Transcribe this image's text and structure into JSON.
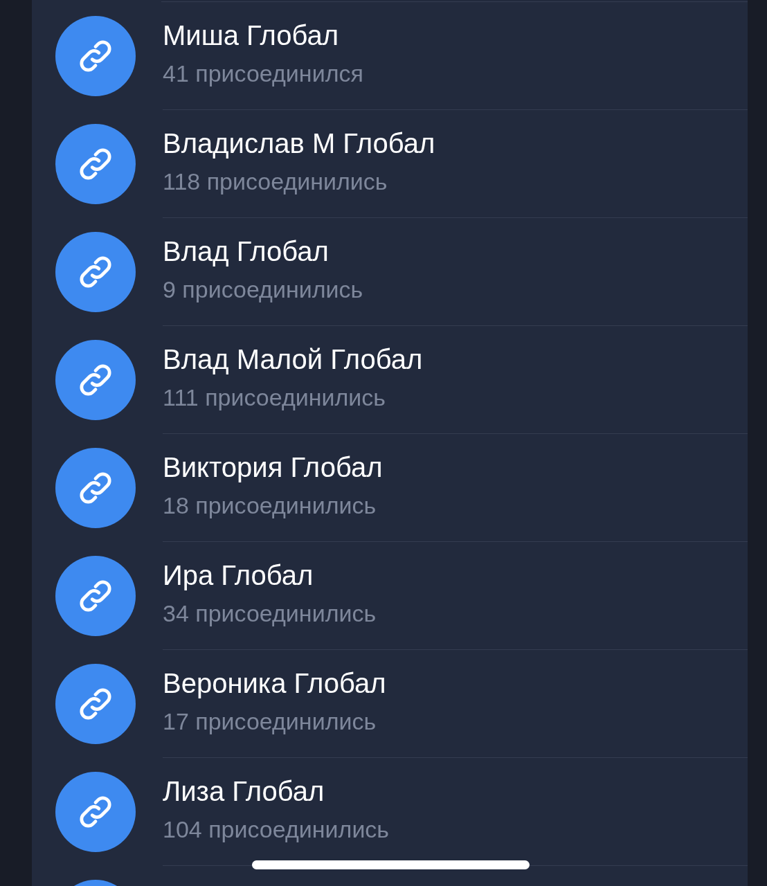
{
  "invite_links": [
    {
      "kind": "link",
      "name": "Миша Глобал",
      "joined": "41 присоединился"
    },
    {
      "kind": "link",
      "name": "Владислав М Глобал",
      "joined": "118 присоединились"
    },
    {
      "kind": "link",
      "name": "Влад Глобал",
      "joined": "9 присоединились"
    },
    {
      "kind": "link",
      "name": "Влад Малой Глобал",
      "joined": "111 присоединились"
    },
    {
      "kind": "link",
      "name": "Виктория Глобал",
      "joined": "18 присоединились"
    },
    {
      "kind": "link",
      "name": "Ира Глобал",
      "joined": "34 присоединились"
    },
    {
      "kind": "link",
      "name": "Вероника Глобал",
      "joined": "17 присоединились"
    },
    {
      "kind": "link",
      "name": "Лиза Глобал",
      "joined": "104 присоединились"
    },
    {
      "kind": "partial"
    }
  ]
}
